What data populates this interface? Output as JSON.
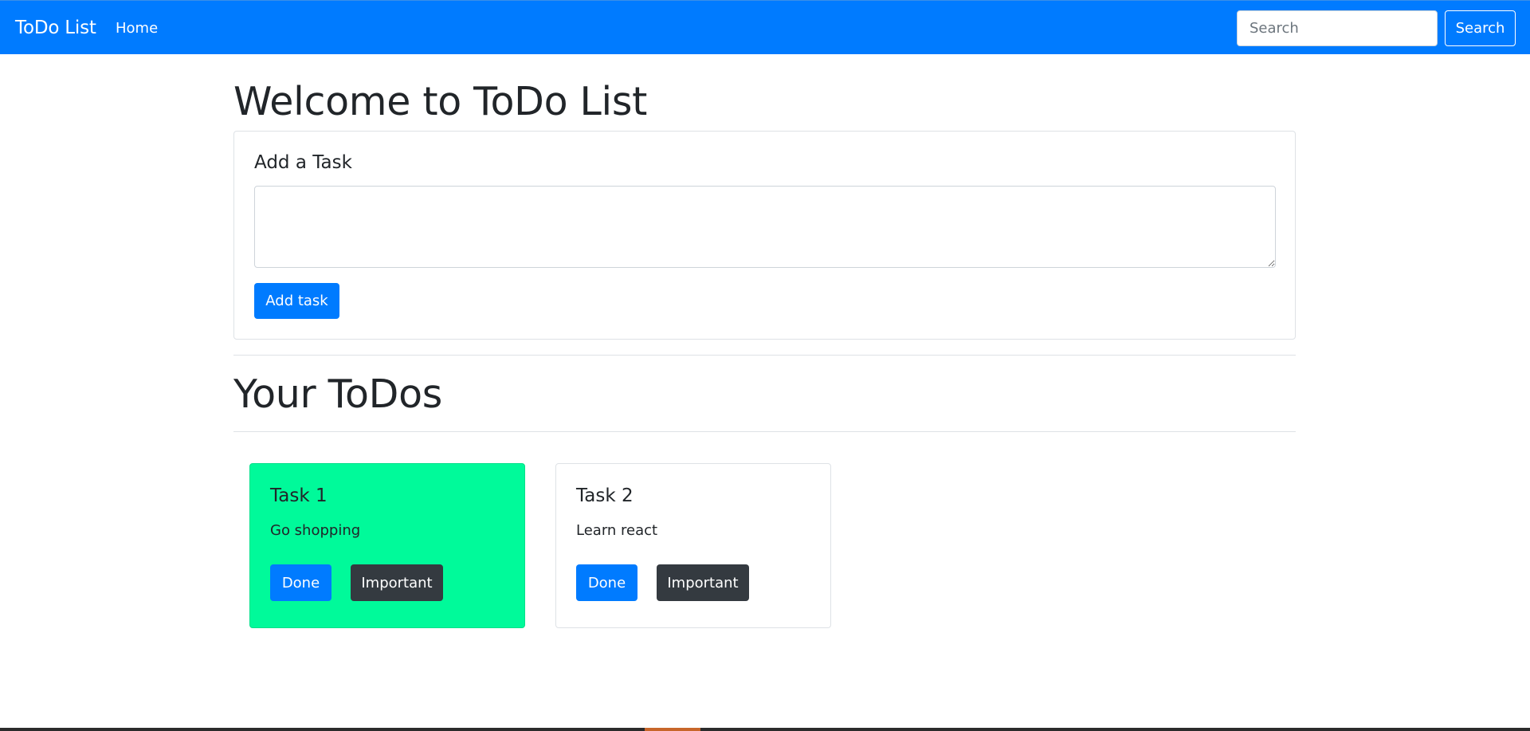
{
  "navbar": {
    "brand": "ToDo List",
    "links": [
      {
        "label": "Home"
      }
    ],
    "search": {
      "placeholder": "Search",
      "value": "",
      "button_label": "Search"
    },
    "background_color": "#007bff"
  },
  "page": {
    "title": "Welcome to ToDo List"
  },
  "add_task": {
    "title": "Add a Task",
    "textarea_value": "",
    "button_label": "Add task"
  },
  "todos_section": {
    "title": "Your ToDos"
  },
  "todos": [
    {
      "title": "Task 1",
      "description": "Go shopping",
      "important": true,
      "highlight_color": "#00fa9a",
      "done_label": "Done",
      "important_label": "Important"
    },
    {
      "title": "Task 2",
      "description": "Learn react",
      "important": false,
      "highlight_color": "#ffffff",
      "done_label": "Done",
      "important_label": "Important"
    }
  ],
  "colors": {
    "primary": "#007bff",
    "dark": "#343a40",
    "important_highlight": "#00fa9a"
  }
}
